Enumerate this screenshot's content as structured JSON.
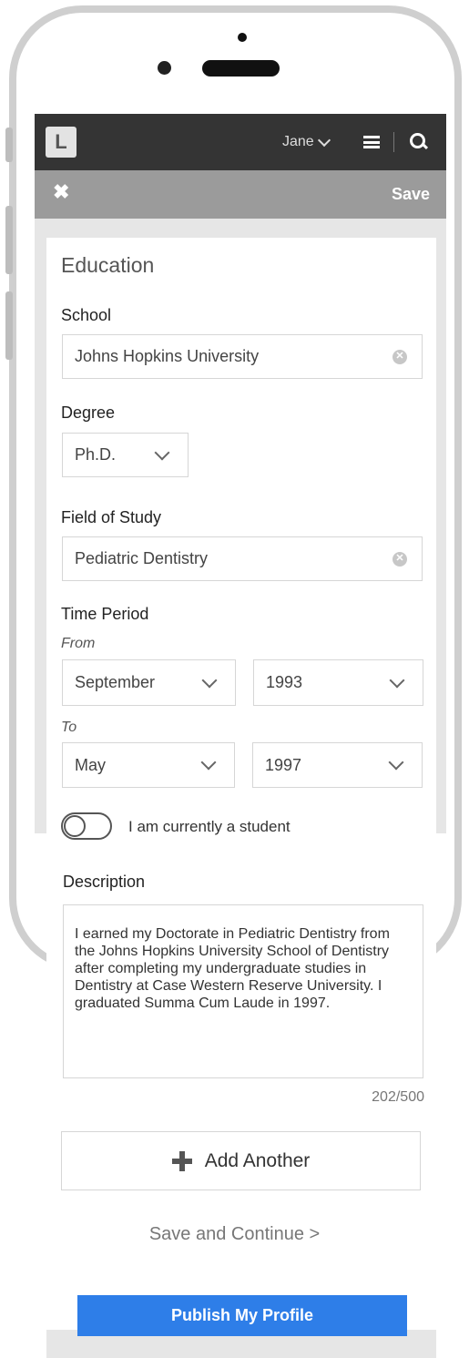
{
  "header": {
    "logo_letter": "L",
    "user_name": "Jane",
    "action_bar": {
      "save_label": "Save"
    }
  },
  "form": {
    "section_title": "Education",
    "school": {
      "label": "School",
      "value": "Johns Hopkins University"
    },
    "degree": {
      "label": "Degree",
      "value": "Ph.D."
    },
    "field_of_study": {
      "label": "Field of Study",
      "value": "Pediatric Dentistry"
    },
    "time_period": {
      "label": "Time Period",
      "from_label": "From",
      "from_month": "September",
      "from_year": "1993",
      "to_label": "To",
      "to_month": "May",
      "to_year": "1997"
    },
    "current_student": {
      "label": "I am currently a student",
      "checked": false
    },
    "description": {
      "label": "Description",
      "value": "I earned my Doctorate in Pediatric Dentistry from the Johns Hopkins University School of Dentistry after completing my undergraduate studies in Dentistry at Case Western Reserve University. I graduated Summa Cum Laude in 1997.",
      "counter": "202/500"
    },
    "add_another_label": "Add Another",
    "save_continue_label": "Save and Continue >",
    "publish_label": "Publish My Profile"
  },
  "colors": {
    "topbar": "#343434",
    "action_bar": "#9b9b9b",
    "publish_button": "#2e7ee8"
  }
}
